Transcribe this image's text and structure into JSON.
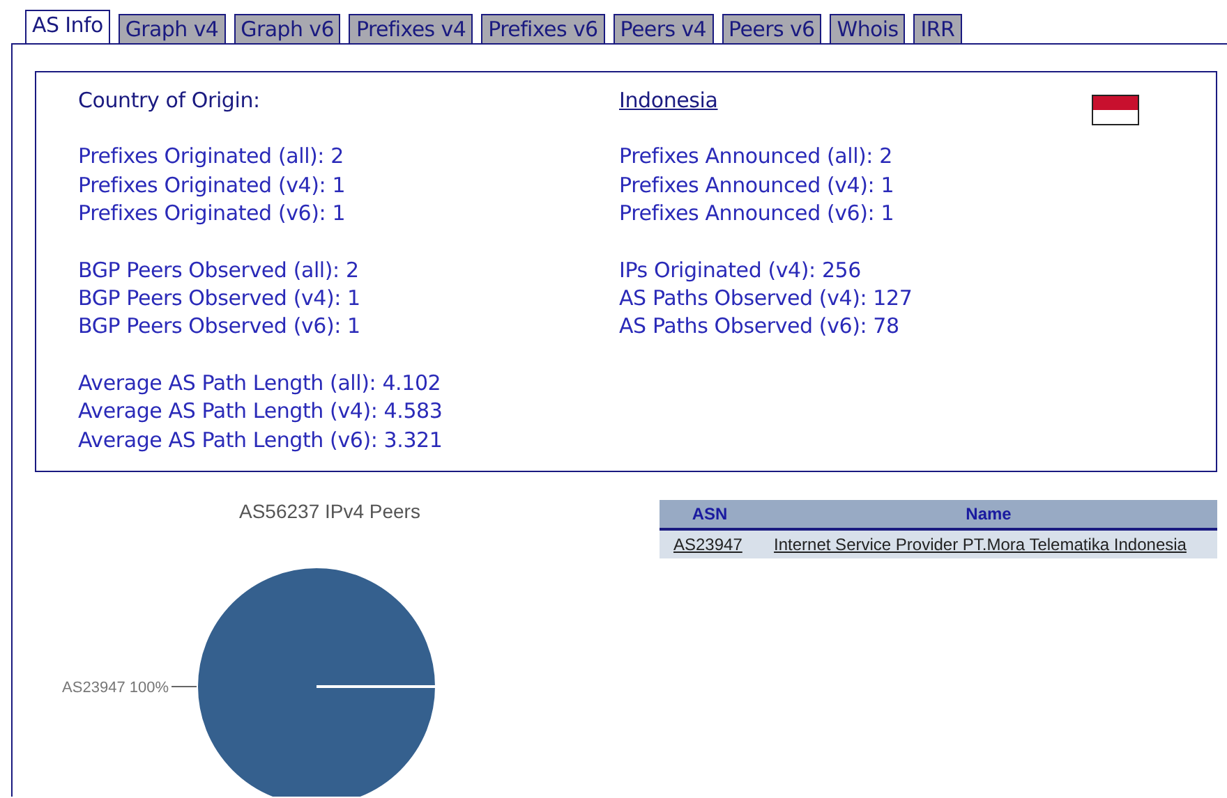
{
  "tabs": [
    {
      "label": "AS Info",
      "selected": true
    },
    {
      "label": "Graph v4",
      "selected": false
    },
    {
      "label": "Graph v6",
      "selected": false
    },
    {
      "label": "Prefixes v4",
      "selected": false
    },
    {
      "label": "Prefixes v6",
      "selected": false
    },
    {
      "label": "Peers v4",
      "selected": false
    },
    {
      "label": "Peers v6",
      "selected": false
    },
    {
      "label": "Whois",
      "selected": false
    },
    {
      "label": "IRR",
      "selected": false
    }
  ],
  "info": {
    "country_label": "Country of Origin:",
    "country": "Indonesia",
    "left_groups": [
      [
        "Prefixes Originated (all): 2",
        "Prefixes Originated (v4): 1",
        "Prefixes Originated (v6): 1"
      ],
      [
        "BGP Peers Observed (all): 2",
        "BGP Peers Observed (v4): 1",
        "BGP Peers Observed (v6): 1"
      ],
      [
        "Average AS Path Length (all): 4.102",
        "Average AS Path Length (v4): 4.583",
        "Average AS Path Length (v6): 3.321"
      ]
    ],
    "right_groups": [
      [
        "Prefixes Announced (all): 2",
        "Prefixes Announced (v4): 1",
        "Prefixes Announced (v6): 1"
      ],
      [
        "IPs Originated (v4): 256",
        "AS Paths Observed (v4): 127",
        "AS Paths Observed (v6): 78"
      ]
    ]
  },
  "peers_chart": {
    "chart_data": {
      "type": "pie",
      "title": "AS56237 IPv4 Peers",
      "categories": [
        "AS23947"
      ],
      "values": [
        100
      ],
      "value_labels": [
        "100%"
      ]
    }
  },
  "peers_table": {
    "columns": [
      "ASN",
      "Name"
    ],
    "rows": [
      [
        "AS23947",
        "Internet Service Provider PT.Mora Telematika Indonesia"
      ]
    ]
  }
}
